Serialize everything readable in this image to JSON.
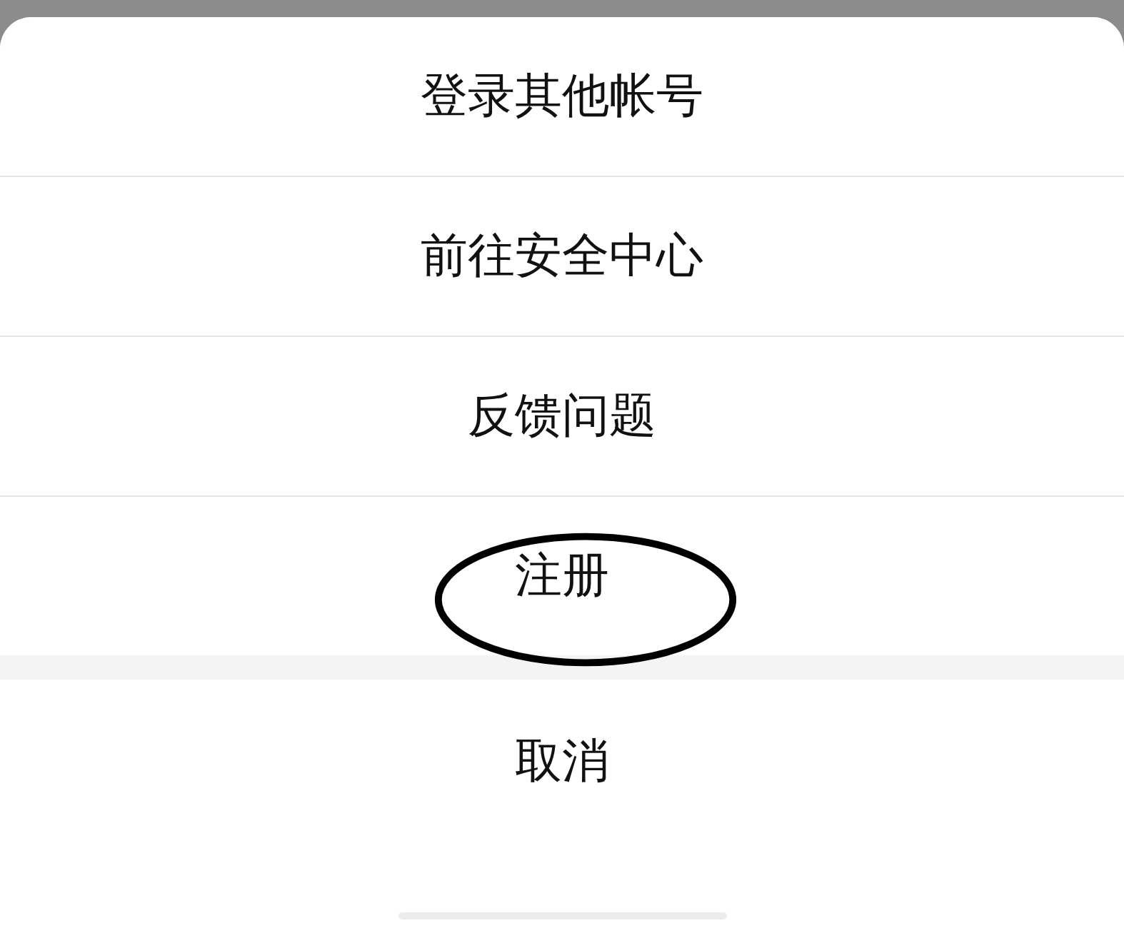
{
  "action_sheet": {
    "items": [
      {
        "label": "登录其他帐号",
        "circled": false
      },
      {
        "label": "前往安全中心",
        "circled": false
      },
      {
        "label": "反馈问题",
        "circled": false
      },
      {
        "label": "注册",
        "circled": true
      }
    ],
    "cancel": {
      "label": "取消"
    }
  }
}
